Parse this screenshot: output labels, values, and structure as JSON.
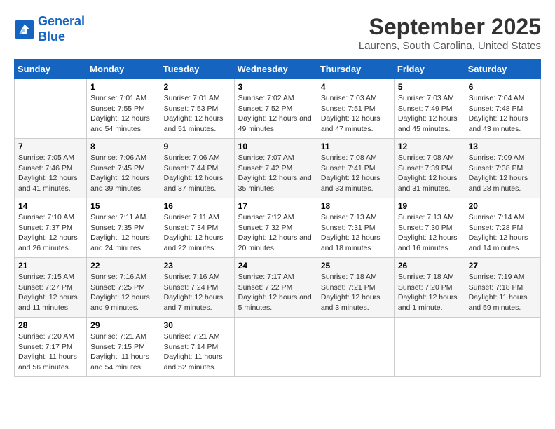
{
  "header": {
    "logo_line1": "General",
    "logo_line2": "Blue",
    "month": "September 2025",
    "location": "Laurens, South Carolina, United States"
  },
  "weekdays": [
    "Sunday",
    "Monday",
    "Tuesday",
    "Wednesday",
    "Thursday",
    "Friday",
    "Saturday"
  ],
  "weeks": [
    [
      {
        "day": "",
        "sunrise": "",
        "sunset": "",
        "daylight": ""
      },
      {
        "day": "1",
        "sunrise": "Sunrise: 7:01 AM",
        "sunset": "Sunset: 7:55 PM",
        "daylight": "Daylight: 12 hours and 54 minutes."
      },
      {
        "day": "2",
        "sunrise": "Sunrise: 7:01 AM",
        "sunset": "Sunset: 7:53 PM",
        "daylight": "Daylight: 12 hours and 51 minutes."
      },
      {
        "day": "3",
        "sunrise": "Sunrise: 7:02 AM",
        "sunset": "Sunset: 7:52 PM",
        "daylight": "Daylight: 12 hours and 49 minutes."
      },
      {
        "day": "4",
        "sunrise": "Sunrise: 7:03 AM",
        "sunset": "Sunset: 7:51 PM",
        "daylight": "Daylight: 12 hours and 47 minutes."
      },
      {
        "day": "5",
        "sunrise": "Sunrise: 7:03 AM",
        "sunset": "Sunset: 7:49 PM",
        "daylight": "Daylight: 12 hours and 45 minutes."
      },
      {
        "day": "6",
        "sunrise": "Sunrise: 7:04 AM",
        "sunset": "Sunset: 7:48 PM",
        "daylight": "Daylight: 12 hours and 43 minutes."
      }
    ],
    [
      {
        "day": "7",
        "sunrise": "Sunrise: 7:05 AM",
        "sunset": "Sunset: 7:46 PM",
        "daylight": "Daylight: 12 hours and 41 minutes."
      },
      {
        "day": "8",
        "sunrise": "Sunrise: 7:06 AM",
        "sunset": "Sunset: 7:45 PM",
        "daylight": "Daylight: 12 hours and 39 minutes."
      },
      {
        "day": "9",
        "sunrise": "Sunrise: 7:06 AM",
        "sunset": "Sunset: 7:44 PM",
        "daylight": "Daylight: 12 hours and 37 minutes."
      },
      {
        "day": "10",
        "sunrise": "Sunrise: 7:07 AM",
        "sunset": "Sunset: 7:42 PM",
        "daylight": "Daylight: 12 hours and 35 minutes."
      },
      {
        "day": "11",
        "sunrise": "Sunrise: 7:08 AM",
        "sunset": "Sunset: 7:41 PM",
        "daylight": "Daylight: 12 hours and 33 minutes."
      },
      {
        "day": "12",
        "sunrise": "Sunrise: 7:08 AM",
        "sunset": "Sunset: 7:39 PM",
        "daylight": "Daylight: 12 hours and 31 minutes."
      },
      {
        "day": "13",
        "sunrise": "Sunrise: 7:09 AM",
        "sunset": "Sunset: 7:38 PM",
        "daylight": "Daylight: 12 hours and 28 minutes."
      }
    ],
    [
      {
        "day": "14",
        "sunrise": "Sunrise: 7:10 AM",
        "sunset": "Sunset: 7:37 PM",
        "daylight": "Daylight: 12 hours and 26 minutes."
      },
      {
        "day": "15",
        "sunrise": "Sunrise: 7:11 AM",
        "sunset": "Sunset: 7:35 PM",
        "daylight": "Daylight: 12 hours and 24 minutes."
      },
      {
        "day": "16",
        "sunrise": "Sunrise: 7:11 AM",
        "sunset": "Sunset: 7:34 PM",
        "daylight": "Daylight: 12 hours and 22 minutes."
      },
      {
        "day": "17",
        "sunrise": "Sunrise: 7:12 AM",
        "sunset": "Sunset: 7:32 PM",
        "daylight": "Daylight: 12 hours and 20 minutes."
      },
      {
        "day": "18",
        "sunrise": "Sunrise: 7:13 AM",
        "sunset": "Sunset: 7:31 PM",
        "daylight": "Daylight: 12 hours and 18 minutes."
      },
      {
        "day": "19",
        "sunrise": "Sunrise: 7:13 AM",
        "sunset": "Sunset: 7:30 PM",
        "daylight": "Daylight: 12 hours and 16 minutes."
      },
      {
        "day": "20",
        "sunrise": "Sunrise: 7:14 AM",
        "sunset": "Sunset: 7:28 PM",
        "daylight": "Daylight: 12 hours and 14 minutes."
      }
    ],
    [
      {
        "day": "21",
        "sunrise": "Sunrise: 7:15 AM",
        "sunset": "Sunset: 7:27 PM",
        "daylight": "Daylight: 12 hours and 11 minutes."
      },
      {
        "day": "22",
        "sunrise": "Sunrise: 7:16 AM",
        "sunset": "Sunset: 7:25 PM",
        "daylight": "Daylight: 12 hours and 9 minutes."
      },
      {
        "day": "23",
        "sunrise": "Sunrise: 7:16 AM",
        "sunset": "Sunset: 7:24 PM",
        "daylight": "Daylight: 12 hours and 7 minutes."
      },
      {
        "day": "24",
        "sunrise": "Sunrise: 7:17 AM",
        "sunset": "Sunset: 7:22 PM",
        "daylight": "Daylight: 12 hours and 5 minutes."
      },
      {
        "day": "25",
        "sunrise": "Sunrise: 7:18 AM",
        "sunset": "Sunset: 7:21 PM",
        "daylight": "Daylight: 12 hours and 3 minutes."
      },
      {
        "day": "26",
        "sunrise": "Sunrise: 7:18 AM",
        "sunset": "Sunset: 7:20 PM",
        "daylight": "Daylight: 12 hours and 1 minute."
      },
      {
        "day": "27",
        "sunrise": "Sunrise: 7:19 AM",
        "sunset": "Sunset: 7:18 PM",
        "daylight": "Daylight: 11 hours and 59 minutes."
      }
    ],
    [
      {
        "day": "28",
        "sunrise": "Sunrise: 7:20 AM",
        "sunset": "Sunset: 7:17 PM",
        "daylight": "Daylight: 11 hours and 56 minutes."
      },
      {
        "day": "29",
        "sunrise": "Sunrise: 7:21 AM",
        "sunset": "Sunset: 7:15 PM",
        "daylight": "Daylight: 11 hours and 54 minutes."
      },
      {
        "day": "30",
        "sunrise": "Sunrise: 7:21 AM",
        "sunset": "Sunset: 7:14 PM",
        "daylight": "Daylight: 11 hours and 52 minutes."
      },
      {
        "day": "",
        "sunrise": "",
        "sunset": "",
        "daylight": ""
      },
      {
        "day": "",
        "sunrise": "",
        "sunset": "",
        "daylight": ""
      },
      {
        "day": "",
        "sunrise": "",
        "sunset": "",
        "daylight": ""
      },
      {
        "day": "",
        "sunrise": "",
        "sunset": "",
        "daylight": ""
      }
    ]
  ]
}
